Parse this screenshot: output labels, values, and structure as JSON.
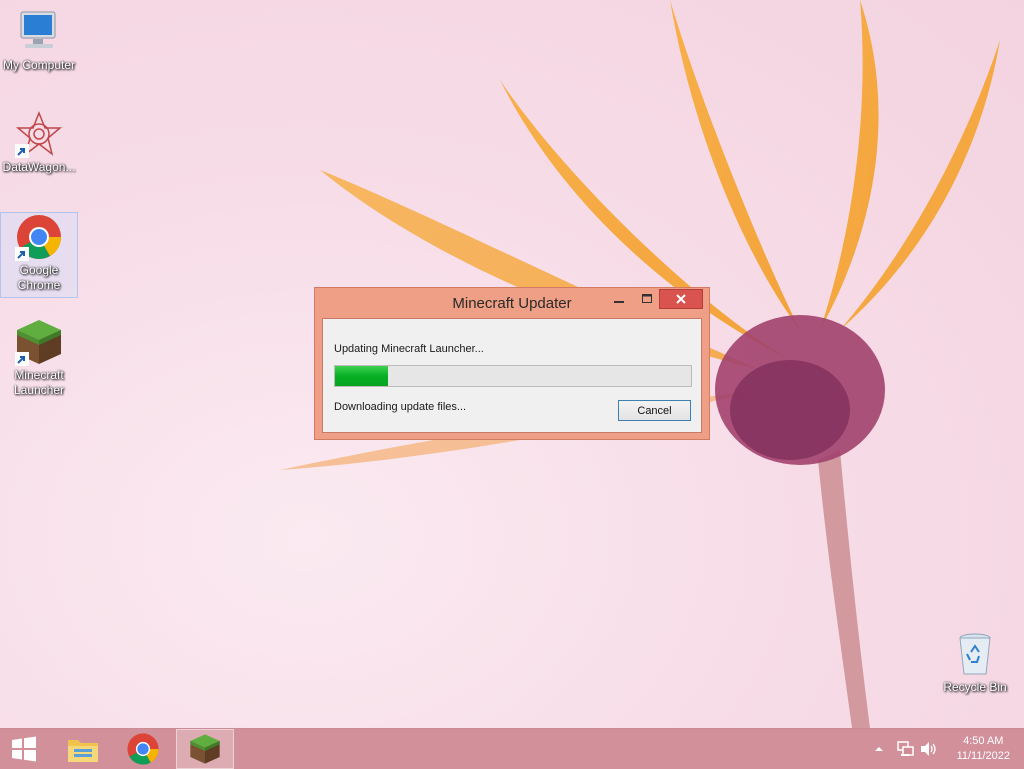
{
  "desktop": {
    "icons": [
      {
        "label": "My Computer",
        "icon": "computer-icon"
      },
      {
        "label": "DataWagon...",
        "icon": "datawagon-icon"
      },
      {
        "label": "Google Chrome",
        "icon": "chrome-icon"
      },
      {
        "label": "Minecraft Launcher",
        "icon": "minecraft-icon"
      },
      {
        "label": "Recycle Bin",
        "icon": "recycle-bin-icon"
      }
    ]
  },
  "dialog": {
    "title": "Minecraft Updater",
    "status_line1": "Updating Minecraft Launcher...",
    "progress": 0.15,
    "status_line2": "Downloading update files...",
    "cancel_label": "Cancel",
    "accent_color": "#ef9f85"
  },
  "taskbar": {
    "items": [
      "start-icon",
      "file-explorer-icon",
      "chrome-icon",
      "minecraft-icon"
    ],
    "tray": {
      "time": "4:50 AM",
      "date": "11/11/2022"
    }
  }
}
